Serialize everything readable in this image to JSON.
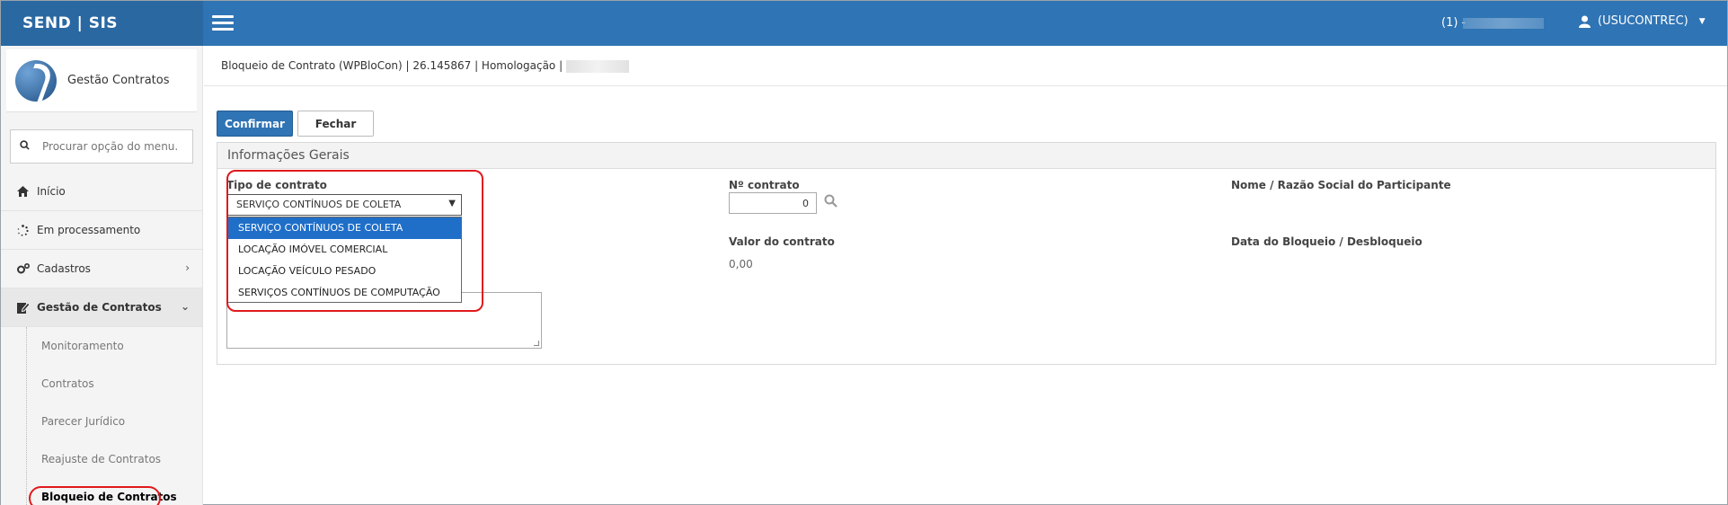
{
  "app": {
    "brand": "SEND | SIS"
  },
  "topbar": {
    "user_count": "(1) -",
    "user_name": "(USUCONTREC)"
  },
  "sidebar": {
    "title": "Gestão Contratos",
    "search_placeholder": "Procurar opção do menu...",
    "items": [
      {
        "label": "Início",
        "icon": "home-icon"
      },
      {
        "label": "Em processamento",
        "icon": "spinner-icon"
      },
      {
        "label": "Cadastros",
        "icon": "gears-icon"
      },
      {
        "label": "Gestão de Contratos",
        "icon": "edit-icon"
      }
    ],
    "sub_items": [
      {
        "label": "Monitoramento"
      },
      {
        "label": "Contratos"
      },
      {
        "label": "Parecer Jurídico"
      },
      {
        "label": "Reajuste de Contratos"
      },
      {
        "label": "Bloqueio de Contratos"
      }
    ]
  },
  "page": {
    "breadcrumb": "Bloqueio de Contrato (WPBloCon) | 26.145867 | Homologação |",
    "confirm_label": "Confirmar",
    "close_label": "Fechar",
    "panel_title": "Informações Gerais"
  },
  "form": {
    "tipo_label": "Tipo de contrato",
    "tipo_value": "SERVIÇO CONTÍNUOS DE COLETA",
    "tipo_options": [
      "SERVIÇO CONTÍNUOS DE COLETA",
      "LOCAÇÃO IMÓVEL COMERCIAL",
      "LOCAÇÃO VEÍCULO PESADO",
      "SERVIÇOS CONTÍNUOS DE COMPUTAÇÃO"
    ],
    "num_label": "Nº contrato",
    "num_value": "0",
    "nome_label": "Nome / Razão Social do Participante",
    "valor_label": "Valor do contrato",
    "valor_value": "0,00",
    "data_label": "Data do Bloqueio / Desbloqueio"
  },
  "colors": {
    "primary": "#2f74b4",
    "highlight": "#e0191c",
    "selected_option": "#1f6fc9"
  }
}
